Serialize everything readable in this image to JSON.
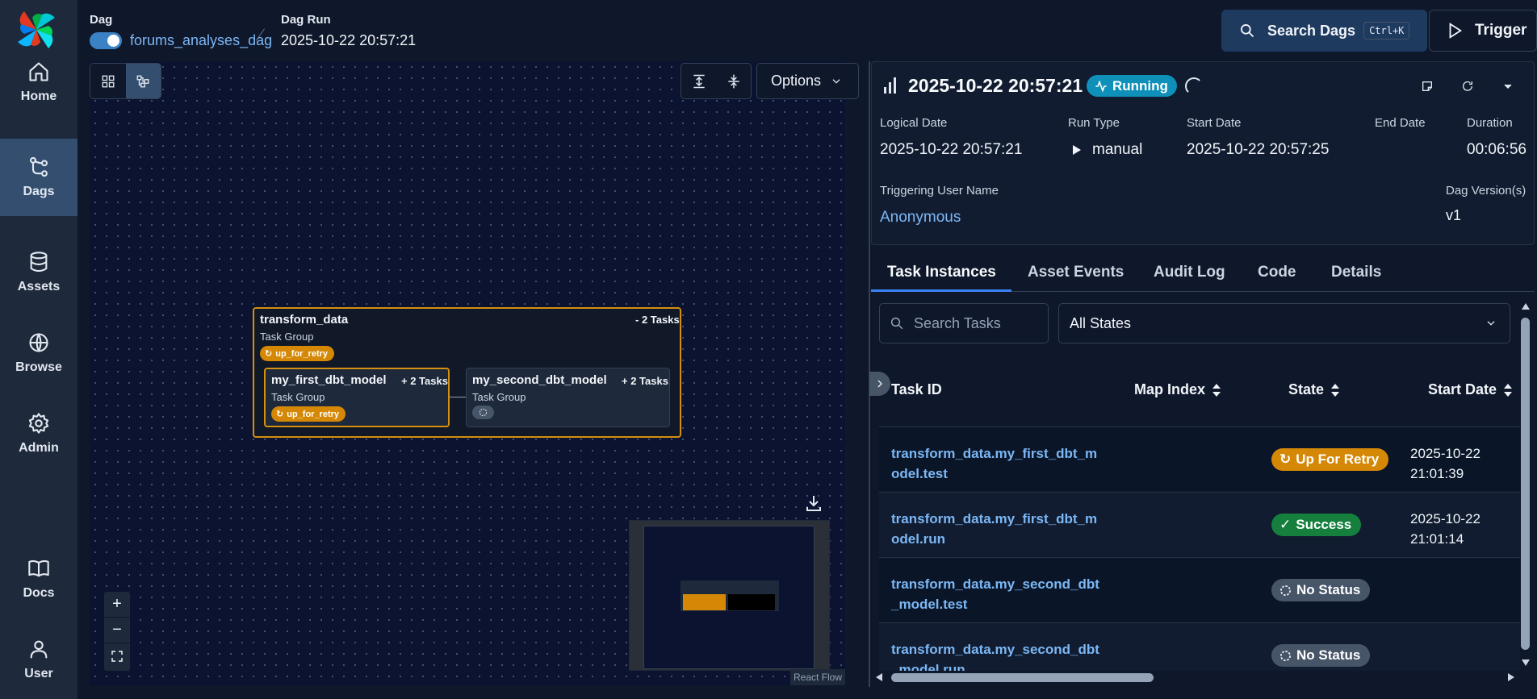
{
  "header": {
    "dag_label": "Dag",
    "dag_name": "forums_analyses_dag",
    "dag_run_label": "Dag Run",
    "dag_run_value": "2025-10-22 20:57:21",
    "search_label": "Search Dags",
    "search_shortcut": "Ctrl+K",
    "trigger_label": "Trigger"
  },
  "sidebar": {
    "items": [
      {
        "label": "Home",
        "icon": "home-icon"
      },
      {
        "label": "Dags",
        "icon": "dags-icon",
        "active": true
      },
      {
        "label": "Assets",
        "icon": "database-icon"
      },
      {
        "label": "Browse",
        "icon": "globe-icon"
      },
      {
        "label": "Admin",
        "icon": "gear-icon"
      },
      {
        "label": "Docs",
        "icon": "book-icon"
      },
      {
        "label": "User",
        "icon": "user-icon"
      }
    ]
  },
  "graph": {
    "options_label": "Options",
    "attribution": "React Flow",
    "group": {
      "title": "transform_data",
      "count": "- 2 Tasks",
      "subtitle": "Task Group",
      "state": "up_for_retry"
    },
    "nodes": [
      {
        "title": "my_first_dbt_model",
        "count": "+ 2 Tasks",
        "subtitle": "Task Group",
        "state": "up_for_retry"
      },
      {
        "title": "my_second_dbt_model",
        "count": "+ 2 Tasks",
        "subtitle": "Task Group",
        "state": ""
      }
    ]
  },
  "run": {
    "title": "2025-10-22 20:57:21",
    "status": "Running",
    "logical_date_label": "Logical Date",
    "logical_date": "2025-10-22 20:57:21",
    "run_type_label": "Run Type",
    "run_type": "manual",
    "start_date_label": "Start Date",
    "start_date": "2025-10-22 20:57:25",
    "end_date_label": "End Date",
    "end_date": "",
    "duration_label": "Duration",
    "duration": "00:06:56",
    "triggering_user_label": "Triggering User Name",
    "triggering_user": "Anonymous",
    "dag_version_label": "Dag Version(s)",
    "dag_version": "v1"
  },
  "tabs": [
    "Task Instances",
    "Asset Events",
    "Audit Log",
    "Code",
    "Details"
  ],
  "filters": {
    "search_placeholder": "Search Tasks",
    "state_value": "All States"
  },
  "table": {
    "columns": [
      "Task ID",
      "Map Index",
      "State",
      "Start Date"
    ],
    "rows": [
      {
        "task_id": "transform_data.my_first_dbt_model.test",
        "state": "Up For Retry",
        "start_date": "2025-10-22 21:01:39"
      },
      {
        "task_id": "transform_data.my_first_dbt_model.run",
        "state": "Success",
        "start_date": "2025-10-22 21:01:14"
      },
      {
        "task_id": "transform_data.my_second_dbt_model.test",
        "state": "No Status",
        "start_date": ""
      },
      {
        "task_id": "transform_data.my_second_dbt_model.run",
        "state": "No Status",
        "start_date": ""
      }
    ]
  },
  "colors": {
    "accent": "#3b82f6",
    "link": "#7cb7f5",
    "retry": "#d48806",
    "success": "#15803d",
    "running": "#0e90b8",
    "no_status": "#475569"
  }
}
